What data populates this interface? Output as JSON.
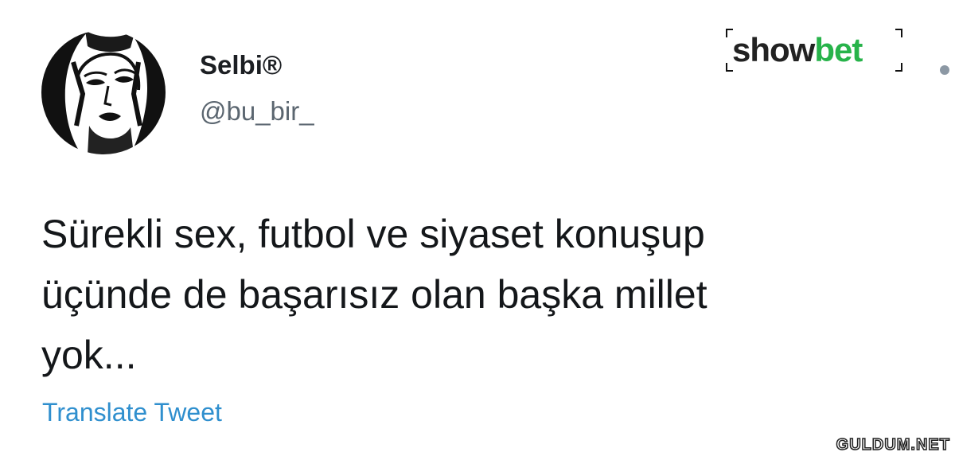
{
  "user": {
    "display_name": "Selbi®",
    "handle": "@bu_bir_"
  },
  "tweet": {
    "lines": [
      "Sürekli sex, futbol ve siyaset konuşup",
      "üçünde de başarısız olan başka millet",
      "yok..."
    ],
    "translate_label": "Translate Tweet"
  },
  "brand": {
    "part_a": "show",
    "part_b": "bet"
  },
  "watermark": "GULDUM.NET",
  "colors": {
    "link": "#2f8fce",
    "brand_green": "#27b34a",
    "handle_gray": "#5b6670"
  },
  "icons": {
    "menu": "more-options-icon",
    "avatar": "avatar-illustration"
  }
}
